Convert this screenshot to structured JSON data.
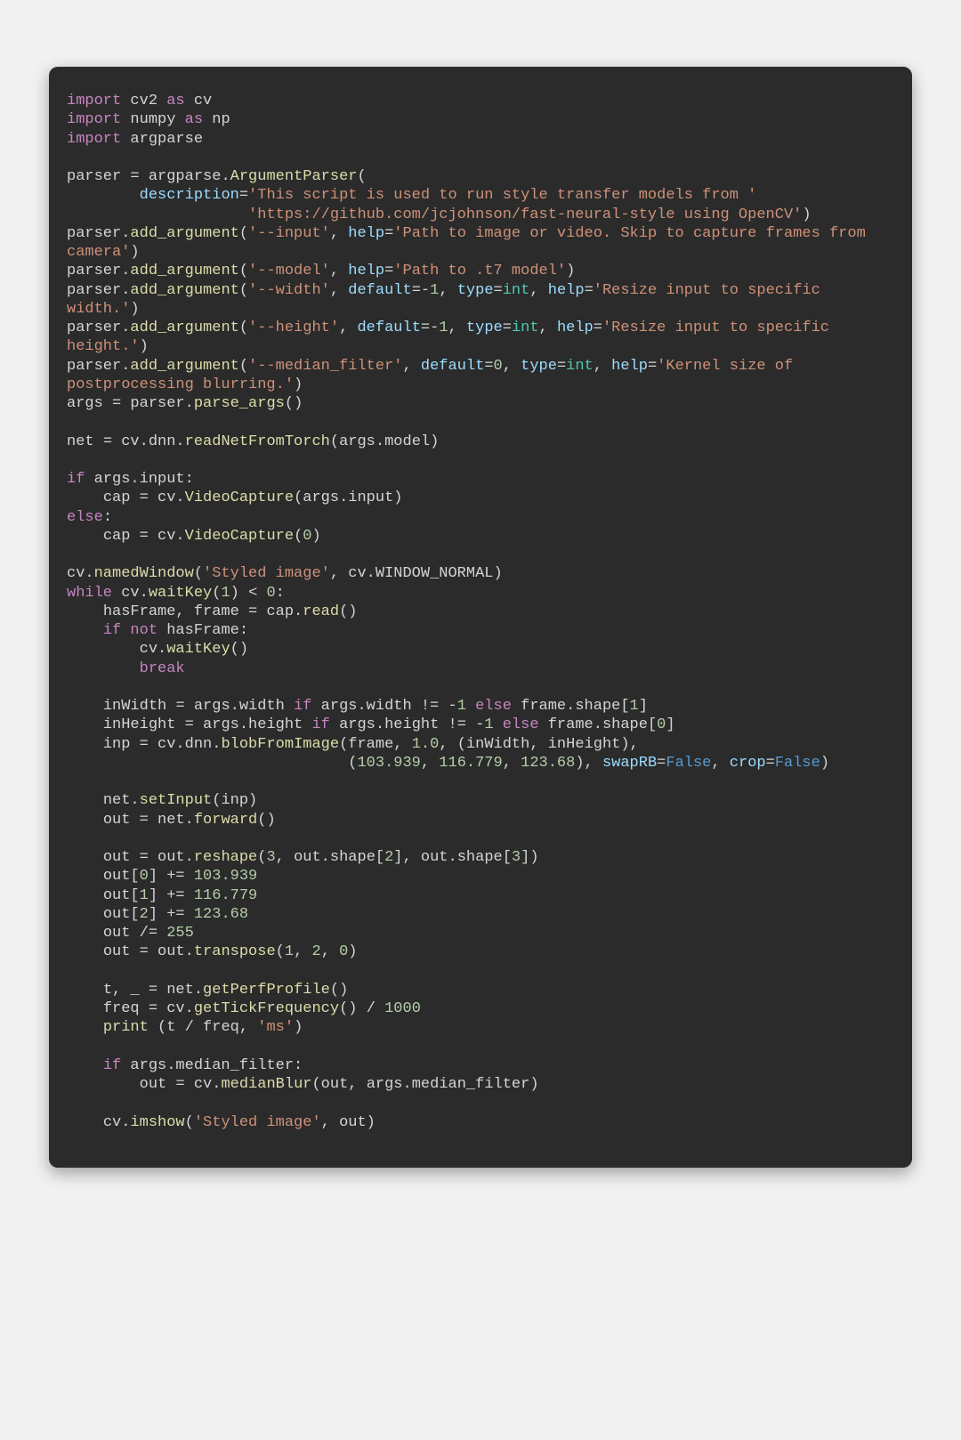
{
  "colors": {
    "page_bg": "#f1f1f1",
    "card_bg": "#2b2b2b",
    "text": "#d4d4d4",
    "keyword": "#c586c0",
    "function": "#dcdcaa",
    "variable": "#9cdcfe",
    "string": "#ce9178",
    "number": "#b5cea8",
    "type": "#4ec9b0",
    "constant": "#569cd6"
  },
  "code": {
    "language": "python",
    "lines": [
      "import cv2 as cv",
      "import numpy as np",
      "import argparse",
      "",
      "parser = argparse.ArgumentParser(",
      "        description='This script is used to run style transfer models from '",
      "                    'https://github.com/jcjohnson/fast-neural-style using OpenCV')",
      "parser.add_argument('--input', help='Path to image or video. Skip to capture frames from camera')",
      "parser.add_argument('--model', help='Path to .t7 model')",
      "parser.add_argument('--width', default=-1, type=int, help='Resize input to specific width.')",
      "parser.add_argument('--height', default=-1, type=int, help='Resize input to specific height.')",
      "parser.add_argument('--median_filter', default=0, type=int, help='Kernel size of postprocessing blurring.')",
      "args = parser.parse_args()",
      "",
      "net = cv.dnn.readNetFromTorch(args.model)",
      "",
      "if args.input:",
      "    cap = cv.VideoCapture(args.input)",
      "else:",
      "    cap = cv.VideoCapture(0)",
      "",
      "cv.namedWindow('Styled image', cv.WINDOW_NORMAL)",
      "while cv.waitKey(1) < 0:",
      "    hasFrame, frame = cap.read()",
      "    if not hasFrame:",
      "        cv.waitKey()",
      "        break",
      "",
      "    inWidth = args.width if args.width != -1 else frame.shape[1]",
      "    inHeight = args.height if args.height != -1 else frame.shape[0]",
      "    inp = cv.dnn.blobFromImage(frame, 1.0, (inWidth, inHeight),",
      "                               (103.939, 116.779, 123.68), swapRB=False, crop=False)",
      "",
      "    net.setInput(inp)",
      "    out = net.forward()",
      "",
      "    out = out.reshape(3, out.shape[2], out.shape[3])",
      "    out[0] += 103.939",
      "    out[1] += 116.779",
      "    out[2] += 123.68",
      "    out /= 255",
      "    out = out.transpose(1, 2, 0)",
      "",
      "    t, _ = net.getPerfProfile()",
      "    freq = cv.getTickFrequency() / 1000",
      "    print (t / freq, 'ms')",
      "",
      "    if args.median_filter:",
      "        out = cv.medianBlur(out, args.median_filter)",
      "",
      "    cv.imshow('Styled image', out)"
    ]
  }
}
